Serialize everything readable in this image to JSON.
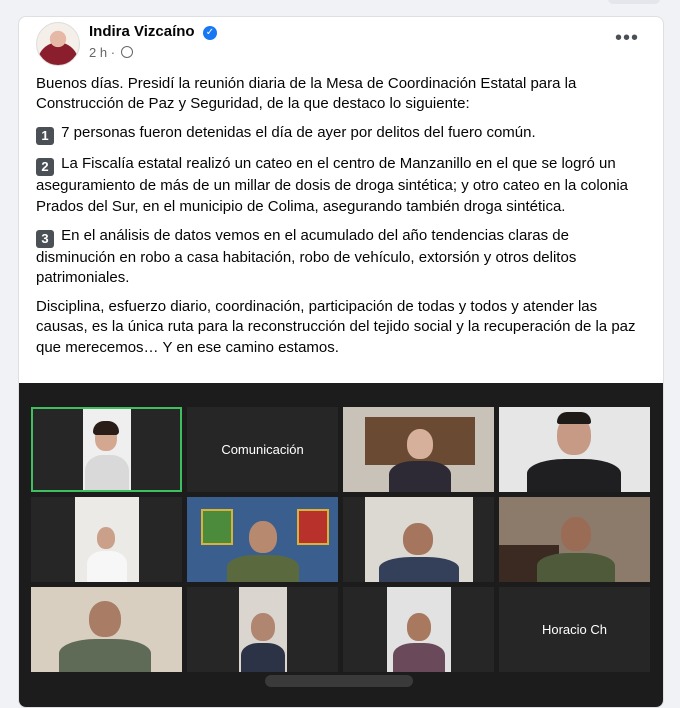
{
  "post": {
    "author": "Indira Vizcaíno",
    "time": "2 h",
    "separator": "·",
    "verified_icon": "verified-badge-icon",
    "privacy_icon": "globe-icon",
    "more_label": "•••",
    "paragraphs": [
      "Buenos días. Presidí la reunión diaria de la Mesa de Coordinación  Estatal para la Construcción de Paz y Seguridad, de la que destaco lo siguiente:",
      "7 personas fueron detenidas el día de ayer por delitos del fuero común.",
      "La Fiscalía estatal realizó un cateo en el centro de Manzanillo en el que se logró un aseguramiento de más de un millar de dosis de droga sintética; y otro cateo en la colonia Prados del Sur, en el municipio de Colima, asegurando también droga sintética.",
      "En el análisis de datos vemos en el acumulado del año tendencias claras de disminución en robo a casa habitación, robo de vehículo, extorsión y otros delitos patrimoniales.",
      "Disciplina, esfuerzo diario, coordinación, participación de todas y todos y atender las causas, es la única ruta para la reconstrucción del tejido social y la recuperación de la paz que merecemos… Y en ese camino estamos."
    ],
    "numbers": [
      "1",
      "2",
      "3"
    ]
  },
  "video_call": {
    "tile_labels": {
      "comunicacion": "Comunicación",
      "horacio": "Horacio Ch"
    }
  },
  "colors": {
    "accent": "#1877f2",
    "active_speaker": "#3fbf5f"
  }
}
